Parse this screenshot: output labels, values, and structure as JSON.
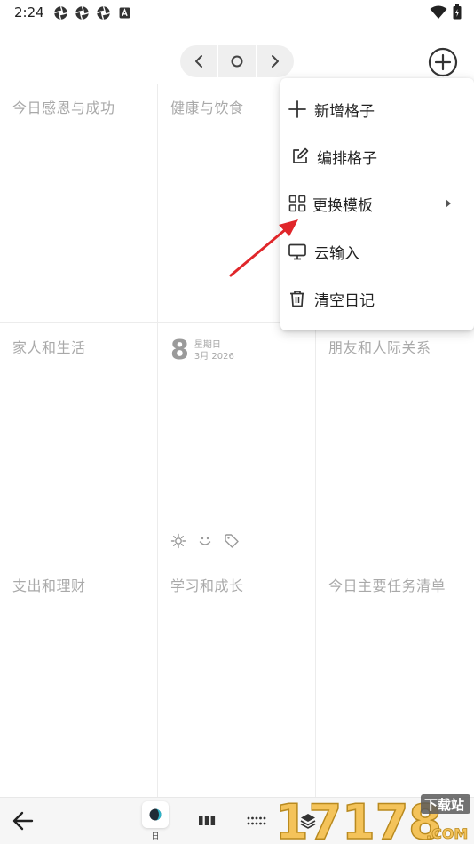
{
  "status_bar": {
    "time": "2:24",
    "icons": [
      "aperture-icon",
      "aperture-icon",
      "aperture-icon",
      "a-badge-icon"
    ],
    "right_icons": [
      "wifi-icon",
      "battery-icon"
    ]
  },
  "nav": {
    "prev_icon": "chevron-left-icon",
    "today_icon": "circle-icon",
    "next_icon": "chevron-right-icon",
    "add_icon": "plus-circle-icon"
  },
  "grid": {
    "cells": [
      {
        "title": "今日感恩与成功"
      },
      {
        "title": "健康与饮食"
      },
      {
        "title": ""
      },
      {
        "title": "家人和生活"
      },
      {
        "title": ""
      },
      {
        "title": "朋友和人际关系"
      },
      {
        "title": "支出和理财"
      },
      {
        "title": "学习和成长"
      },
      {
        "title": "今日主要任务清单"
      }
    ],
    "date": {
      "day": "8",
      "weekday": "星期日",
      "month_year": "3月 2026"
    },
    "date_icons": [
      "sun-icon",
      "smile-icon",
      "tag-icon"
    ]
  },
  "menu": {
    "items": [
      {
        "label": "新增格子",
        "icon": "plus-icon"
      },
      {
        "label": "编排格子",
        "icon": "edit-icon"
      },
      {
        "label": "更换模板",
        "icon": "grid-icon",
        "has_submenu": true
      },
      {
        "label": "云输入",
        "icon": "monitor-icon"
      },
      {
        "label": "清空日记",
        "icon": "trash-icon"
      }
    ]
  },
  "bottom_bar": {
    "day_label": "日",
    "watermark_main": "17178",
    "watermark_sub": "下载站",
    "watermark_com": ".COM"
  },
  "colors": {
    "annotation": "#e0262a",
    "grid_line": "#ececec",
    "cell_title": "#a9a9a9"
  }
}
